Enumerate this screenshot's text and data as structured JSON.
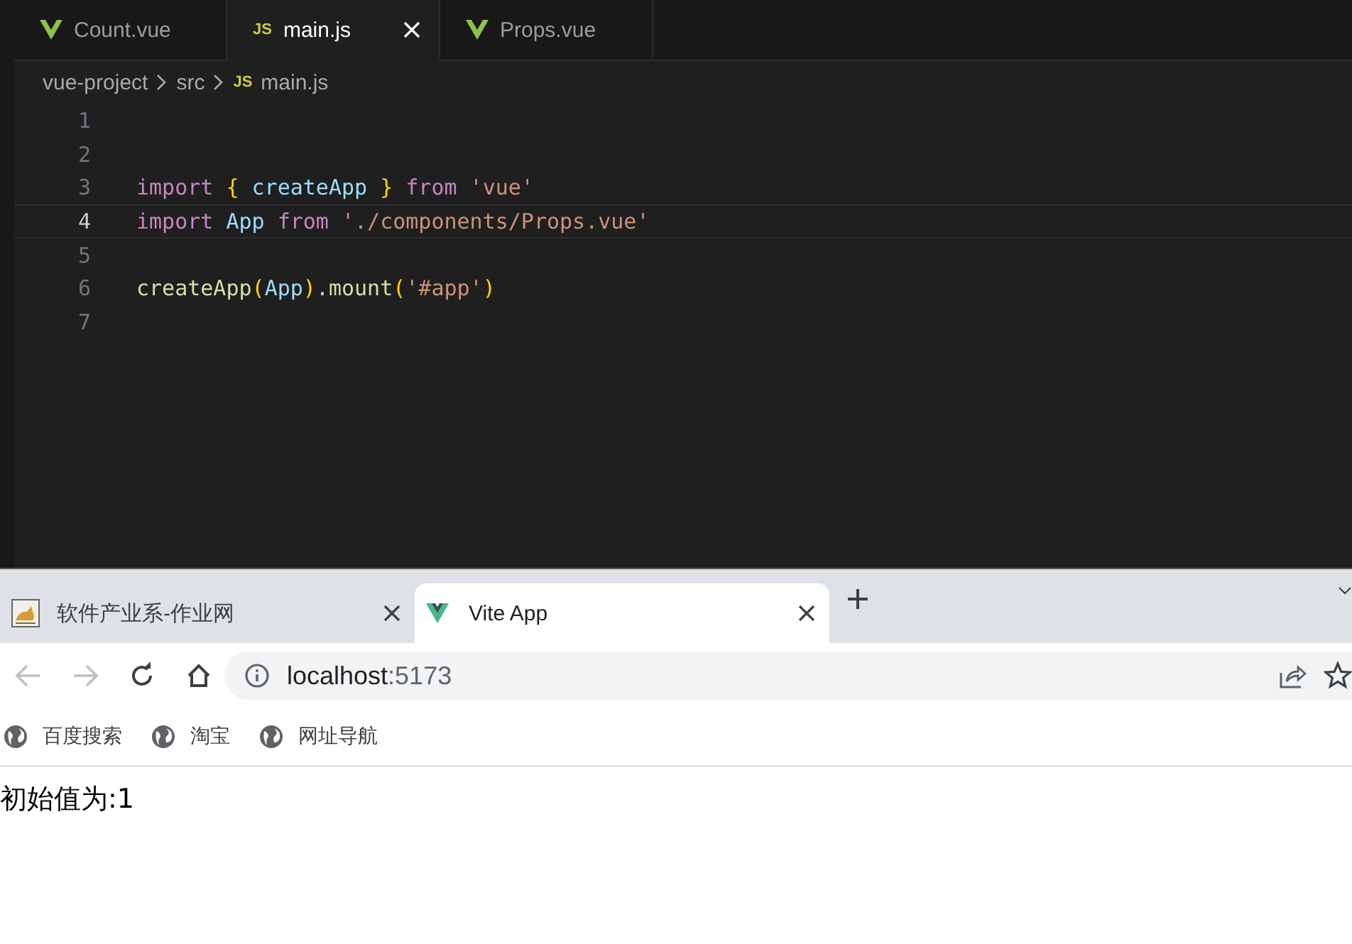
{
  "editor": {
    "tabs": [
      {
        "kind": "vue",
        "label": "Count.vue",
        "selected": false
      },
      {
        "kind": "js",
        "badge": "JS",
        "label": "main.js",
        "selected": true
      },
      {
        "kind": "vue",
        "label": "Props.vue",
        "selected": false
      }
    ],
    "breadcrumb": [
      {
        "label": "vue-project"
      },
      {
        "label": "src"
      },
      {
        "badge": "JS",
        "label": "main.js"
      }
    ],
    "lines": [
      {
        "number": "1",
        "current": false
      },
      {
        "number": "2",
        "current": false
      },
      {
        "number": "3",
        "current": false,
        "tokens": [
          {
            "kind": "keyword",
            "text": "import"
          },
          {
            "kind": "brace",
            "text": " {"
          },
          {
            "kind": "variable",
            "text": " createApp"
          },
          {
            "kind": "brace",
            "text": " }"
          },
          {
            "kind": "keyword",
            "text": " from"
          },
          {
            "kind": "string",
            "text": " 'vue'"
          }
        ]
      },
      {
        "number": "4",
        "current": true,
        "tokens": [
          {
            "kind": "keyword",
            "text": "import"
          },
          {
            "kind": "variable",
            "text": " App"
          },
          {
            "kind": "keyword",
            "text": " from"
          },
          {
            "kind": "string",
            "text": " './components/Props.vue'"
          }
        ]
      },
      {
        "number": "5",
        "current": false
      },
      {
        "number": "6",
        "current": false,
        "tokens": [
          {
            "kind": "function",
            "text": "createApp"
          },
          {
            "kind": "brace",
            "text": "("
          },
          {
            "kind": "variable",
            "text": "App"
          },
          {
            "kind": "brace",
            "text": ")"
          },
          {
            "kind": "plain",
            "text": "."
          },
          {
            "kind": "function",
            "text": "mount"
          },
          {
            "kind": "brace",
            "text": "("
          },
          {
            "kind": "string",
            "text": "'#app'"
          },
          {
            "kind": "brace",
            "text": ")"
          }
        ]
      },
      {
        "number": "7",
        "current": false
      }
    ]
  },
  "browser": {
    "tabs": [
      {
        "kind": "cat",
        "title": "软件产业系-作业网",
        "selected": false
      },
      {
        "kind": "vue",
        "title": "Vite App",
        "selected": true
      }
    ],
    "address": {
      "host": "localhost",
      "port": ":5173"
    },
    "bookmarks": [
      {
        "label": "百度搜索"
      },
      {
        "label": "淘宝"
      },
      {
        "label": "网址导航"
      }
    ],
    "content": "初始值为:1"
  }
}
